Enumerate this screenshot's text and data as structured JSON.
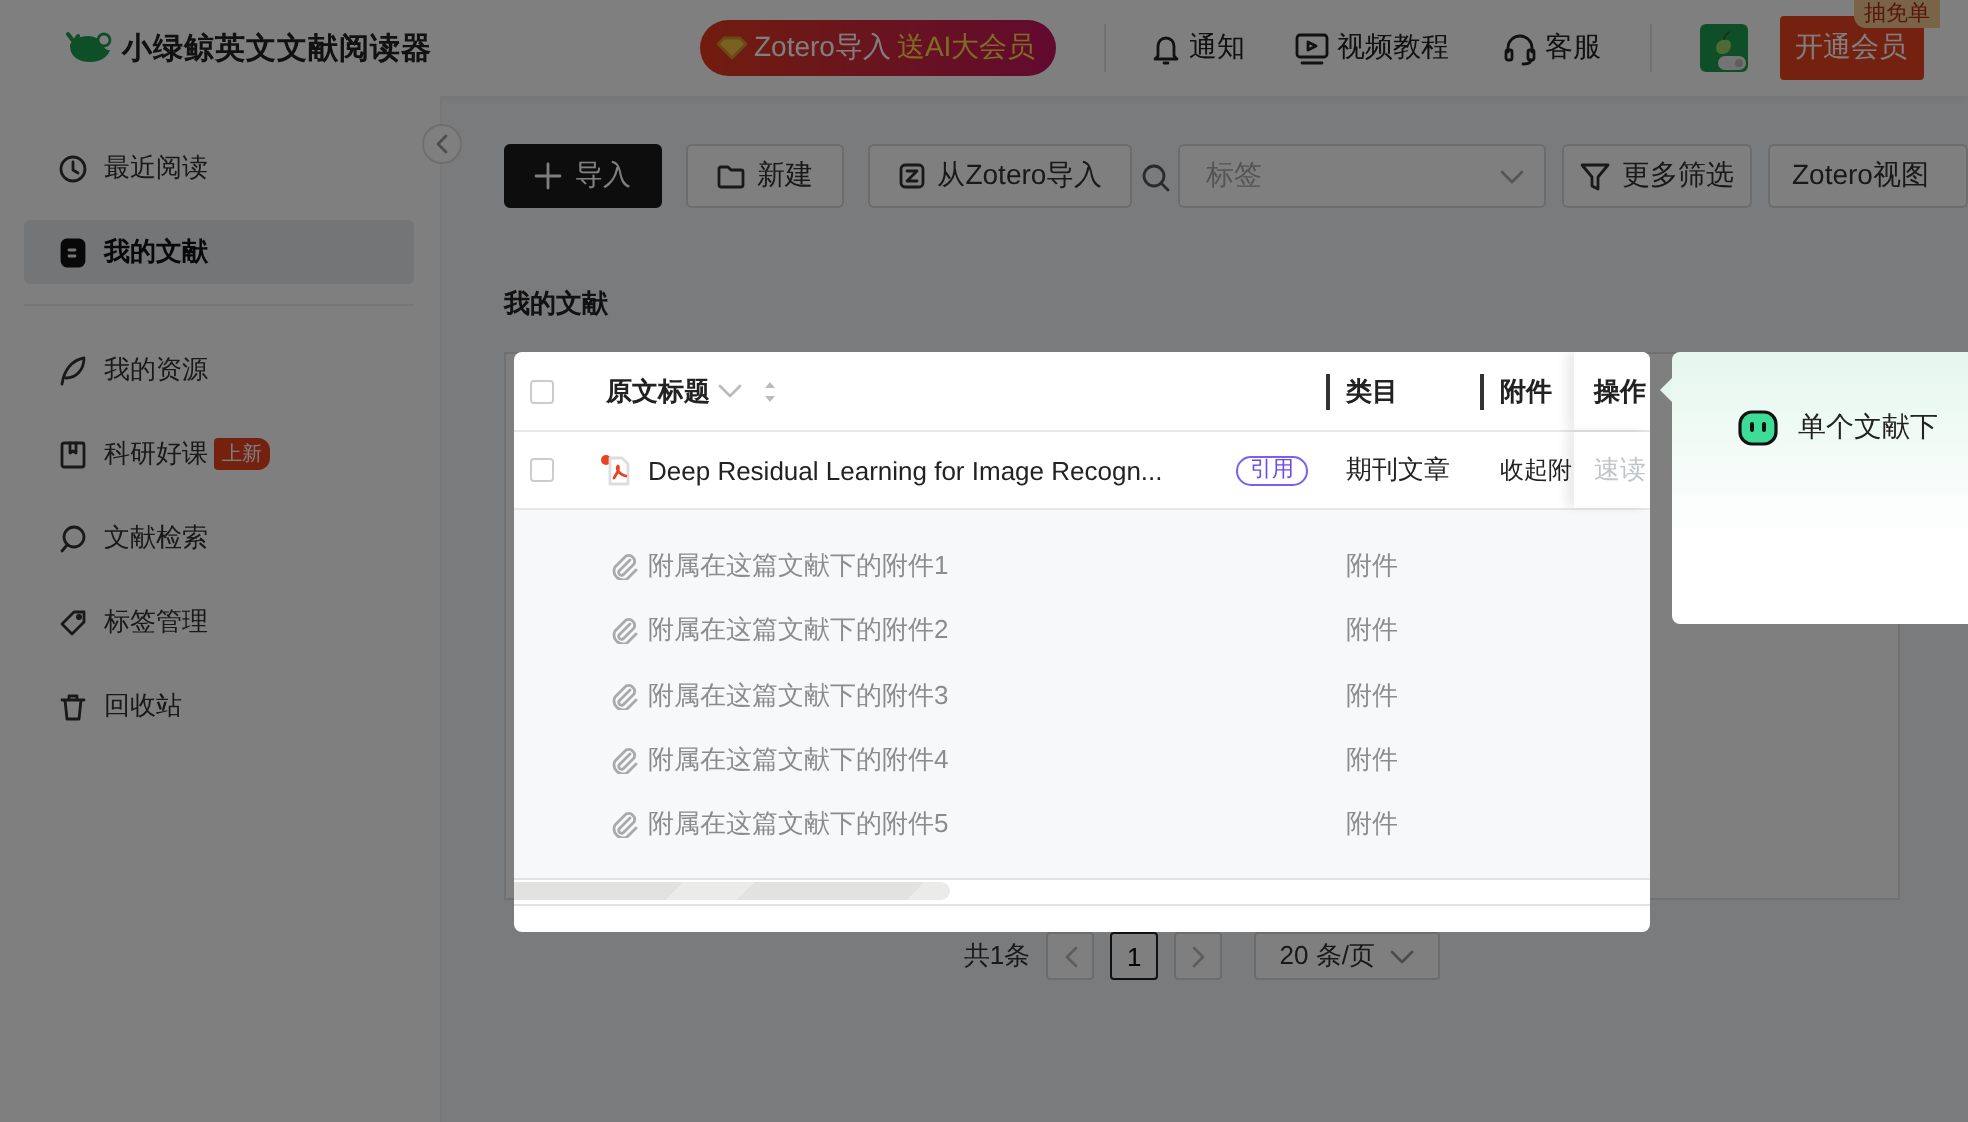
{
  "app": {
    "title": "小绿鲸英文文献阅读器"
  },
  "promo": {
    "label": "Zotero导入",
    "highlight": "送AI大会员"
  },
  "nav": [
    {
      "label": "通知",
      "kind": "bell"
    },
    {
      "label": "视频教程",
      "kind": "video"
    },
    {
      "label": "客服",
      "kind": "headset"
    }
  ],
  "upgrade": {
    "label": "开通会员",
    "badge": "抽免单"
  },
  "sidebar": {
    "items": [
      {
        "label": "最近阅读",
        "kind": "clock",
        "selected": false
      },
      {
        "label": "我的文献",
        "kind": "doc",
        "selected": true,
        "divider_after": true
      },
      {
        "label": "我的资源",
        "kind": "leaf",
        "selected": false
      },
      {
        "label": "科研好课",
        "kind": "book",
        "selected": false,
        "badge": "上新"
      },
      {
        "label": "文献检索",
        "kind": "search",
        "selected": false
      },
      {
        "label": "标签管理",
        "kind": "tag",
        "selected": false
      },
      {
        "label": "回收站",
        "kind": "trash",
        "selected": false
      }
    ]
  },
  "toolbar": {
    "buttons": [
      {
        "label": "导入",
        "kind": "import"
      },
      {
        "label": "新建",
        "kind": "folder"
      },
      {
        "label": "从Zotero导入",
        "kind": "zotero"
      }
    ],
    "tag_select": {
      "placeholder": "标签"
    },
    "filter": {
      "label": "更多筛选"
    },
    "view": {
      "label": "Zotero视图"
    }
  },
  "section_title": "我的文献",
  "table": {
    "select_all": {
      "checked": false
    },
    "columns": [
      "原文标题",
      "类目",
      "附件",
      "操作"
    ],
    "rows": [
      {
        "checked": false,
        "title": "Deep Residual Learning for Image Recogn...",
        "tag": "引用",
        "category": "期刊文章",
        "attachment": "收起附",
        "action": "速读",
        "attachments": [
          {
            "title": "附属在这篇文献下的附件1",
            "category": "附件"
          },
          {
            "title": "附属在这篇文献下的附件2",
            "category": "附件"
          },
          {
            "title": "附属在这篇文献下的附件3",
            "category": "附件"
          },
          {
            "title": "附属在这篇文献下的附件4",
            "category": "附件"
          },
          {
            "title": "附属在这篇文献下的附件5",
            "category": "附件"
          }
        ]
      }
    ]
  },
  "pagination": {
    "total": "共1条",
    "pages": [
      {
        "label": "1",
        "selected": true
      }
    ],
    "page_size": "20 条/页"
  },
  "guide": {
    "text": "单个文献下"
  }
}
